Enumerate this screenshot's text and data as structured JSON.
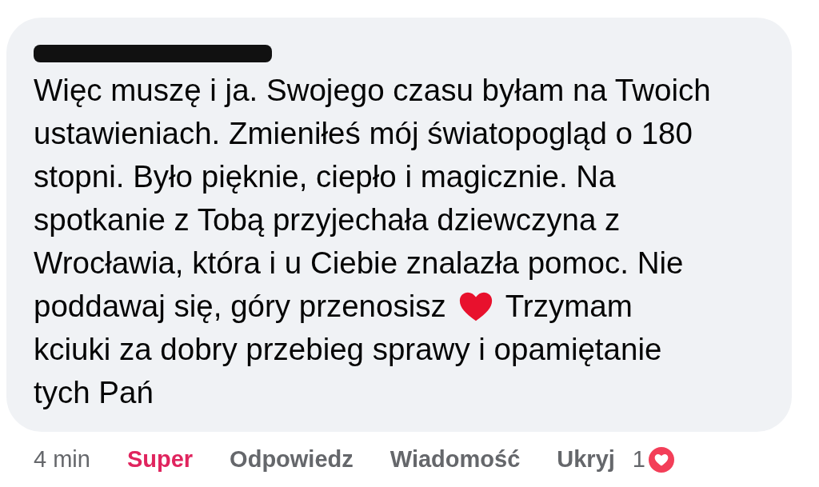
{
  "comment": {
    "author_redacted": true,
    "lines": [
      {
        "parts": [
          {
            "kind": "text",
            "text": "Więc muszę i ja. Swojego czasu byłam na Twoich"
          }
        ]
      },
      {
        "parts": [
          {
            "kind": "text",
            "text": "ustawieniach. Zmieniłeś mój światopogląd o 180"
          }
        ]
      },
      {
        "parts": [
          {
            "kind": "text",
            "text": "stopni. Było pięknie, ciepło i magicznie. Na"
          }
        ]
      },
      {
        "parts": [
          {
            "kind": "text",
            "text": "spotkanie z Tobą przyjechała dziewczyna z"
          }
        ]
      },
      {
        "parts": [
          {
            "kind": "text",
            "text": "Wrocławia, która i u Ciebie znalazła pomoc. Nie"
          }
        ]
      },
      {
        "parts": [
          {
            "kind": "text",
            "text": "poddawaj się, góry przenosisz"
          },
          {
            "kind": "heart"
          },
          {
            "kind": "text",
            "text": "Trzymam"
          }
        ]
      },
      {
        "parts": [
          {
            "kind": "text",
            "text": "kciuki za dobry przebieg sprawy i opamiętanie"
          }
        ]
      },
      {
        "parts": [
          {
            "kind": "text",
            "text": "tych Pań"
          }
        ]
      }
    ]
  },
  "actions": [
    {
      "kind": "time",
      "text": "4 min"
    },
    {
      "kind": "reaction",
      "text": "Super"
    },
    {
      "kind": "action",
      "text": "Odpowiedz"
    },
    {
      "kind": "action",
      "text": "Wiadomość"
    },
    {
      "kind": "action",
      "text": "Ukryj"
    }
  ],
  "reactions": {
    "count": "1"
  }
}
